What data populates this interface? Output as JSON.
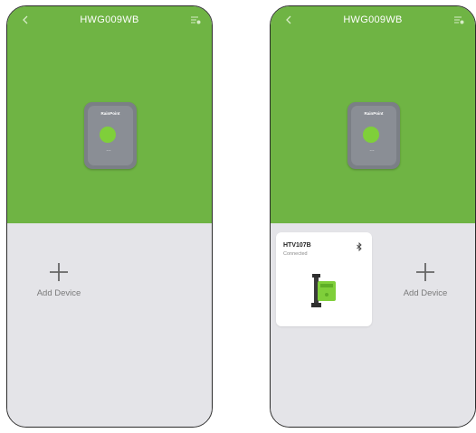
{
  "screens": [
    {
      "header": {
        "title": "HWG009WB"
      },
      "hub": {
        "brand": "RainPoint"
      },
      "add_device": {
        "label": "Add Device"
      }
    },
    {
      "header": {
        "title": "HWG009WB"
      },
      "hub": {
        "brand": "RainPoint"
      },
      "device_card": {
        "name": "HTV107B",
        "status": "Connected"
      },
      "add_device": {
        "label": "Add Device"
      }
    }
  ],
  "colors": {
    "accent": "#6fb444",
    "background": "#e4e4e8",
    "hub_body": "#7b7f86",
    "hub_button": "#7fcf3a"
  },
  "icons": [
    "back-icon",
    "menu-settings-icon",
    "plus-icon",
    "bluetooth-icon"
  ]
}
